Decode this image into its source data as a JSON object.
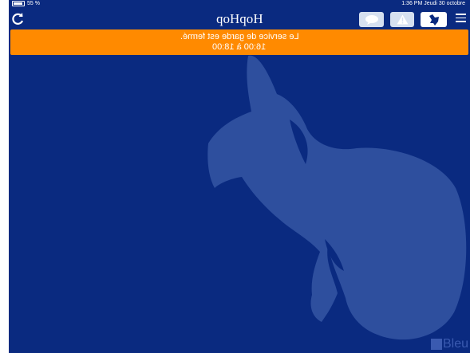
{
  "status_bar": {
    "left_text": "55 %",
    "right_text": "1:36 PM   Jeudi 30 octobre"
  },
  "nav": {
    "title": "HopHop",
    "icons": {
      "refresh": "refresh-icon",
      "chat": "speech-bubble-icon",
      "alert": "warning-triangle-icon",
      "map": "map-icon",
      "menu": "hamburger-menu-icon"
    }
  },
  "banner": {
    "line1": "Le service de garde est fermé.",
    "line2": "16:00 à 18:00"
  },
  "branding": {
    "logo_text": "Bleu"
  },
  "colors": {
    "background": "#0a2a80",
    "banner": "#ff8a00",
    "watermark": "#2e4f9e"
  }
}
